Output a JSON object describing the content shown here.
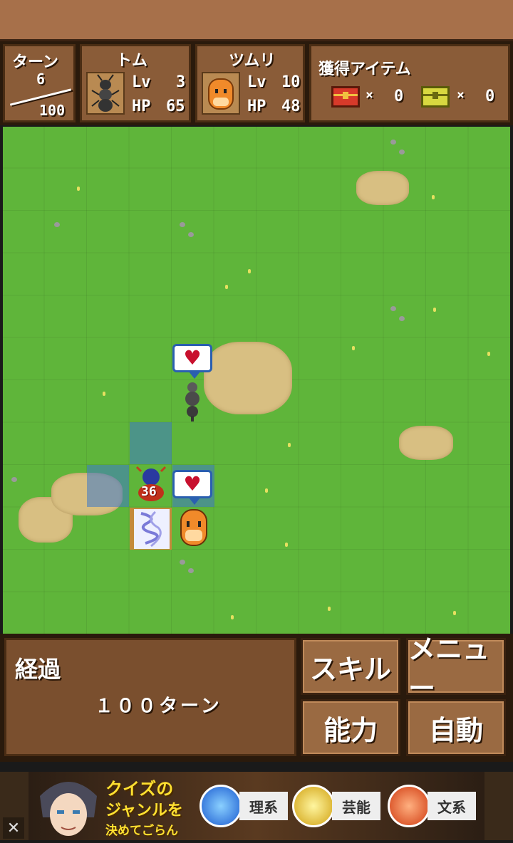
{
  "hud": {
    "turn_label": "ターン",
    "turn_current": "6",
    "turn_max": "100",
    "characters": [
      {
        "name": "トム",
        "lv_label": "Lv",
        "lv": "3",
        "hp_label": "HP",
        "hp": "65"
      },
      {
        "name": "ツムリ",
        "lv_label": "Lv",
        "lv": "10",
        "hp_label": "HP",
        "hp": "48"
      }
    ],
    "items_title": "獲得アイテム",
    "item_red_mult": "×",
    "item_red_count": "0",
    "item_yellow_mult": "×",
    "item_yellow_count": "0"
  },
  "map": {
    "enemy_badge": "36"
  },
  "message": {
    "title": "経過",
    "text": "１００ターン"
  },
  "buttons": {
    "skill": "スキル",
    "menu": "メニュー",
    "ability": "能力",
    "auto": "自動"
  },
  "ad": {
    "headline_1": "クイズの",
    "headline_2": "ジャンルを",
    "headline_3": "決めてごらん",
    "genre_1": "理系",
    "genre_2": "芸能",
    "genre_3": "文系",
    "close": "✕"
  },
  "colors": {
    "grass": "#5fb53a",
    "sand": "#d8bf82",
    "panel": "#8a5c38",
    "highlight": "#3c78c8"
  }
}
